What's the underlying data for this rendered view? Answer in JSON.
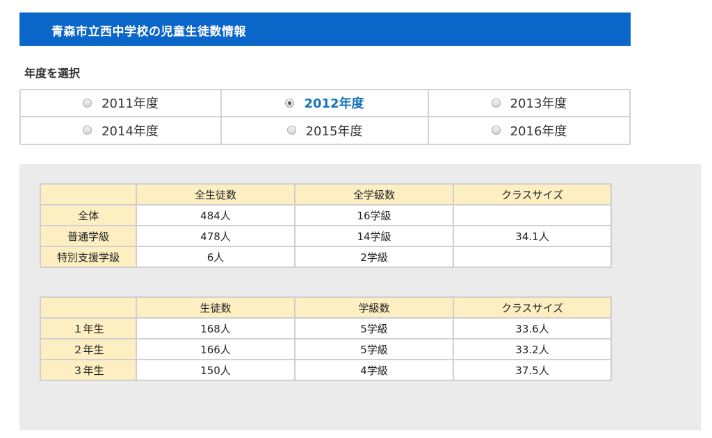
{
  "header": {
    "title": "青森市立西中学校の児童生徒数情報"
  },
  "year_select": {
    "label": "年度を選択",
    "options": [
      {
        "label": "2011年度",
        "selected": false
      },
      {
        "label": "2012年度",
        "selected": true
      },
      {
        "label": "2013年度",
        "selected": false
      },
      {
        "label": "2014年度",
        "selected": false
      },
      {
        "label": "2015年度",
        "selected": false
      },
      {
        "label": "2016年度",
        "selected": false
      }
    ]
  },
  "table1": {
    "headers": [
      "",
      "全生徒数",
      "全学級数",
      "クラスサイズ"
    ],
    "rows": [
      [
        "全体",
        "484人",
        "16学級",
        ""
      ],
      [
        "普通学級",
        "478人",
        "14学級",
        "34.1人"
      ],
      [
        "特別支援学級",
        "6人",
        "2学級",
        ""
      ]
    ]
  },
  "table2": {
    "headers": [
      "",
      "生徒数",
      "学級数",
      "クラスサイズ"
    ],
    "rows": [
      [
        "１年生",
        "168人",
        "5学級",
        "33.6人"
      ],
      [
        "２年生",
        "166人",
        "5学級",
        "33.2人"
      ],
      [
        "３年生",
        "150人",
        "4学級",
        "37.5人"
      ]
    ]
  },
  "colors": {
    "header_bg": "#0a66c9",
    "header_cell_bg": "#fdefc2",
    "selected_year": "#1a73b8",
    "panel_bg": "#ebebeb"
  }
}
